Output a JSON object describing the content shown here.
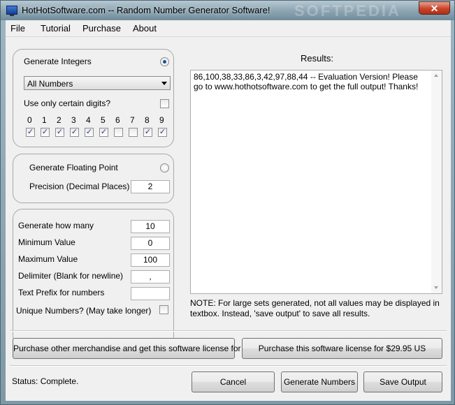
{
  "window": {
    "title": "HotHotSoftware.com -- Random Number Generator Software!",
    "watermark": "SOFTPEDIA",
    "close_glyph": "✕"
  },
  "menu": [
    "File",
    "Tutorial",
    "Purchase",
    "About"
  ],
  "integers": {
    "label": "Generate Integers",
    "selected": true,
    "dropdown_value": "All Numbers",
    "only_digits_label": "Use only certain digits?",
    "only_digits_checked": false,
    "digits": [
      {
        "label": "0",
        "checked": true
      },
      {
        "label": "1",
        "checked": true
      },
      {
        "label": "2",
        "checked": true
      },
      {
        "label": "3",
        "checked": true
      },
      {
        "label": "4",
        "checked": true
      },
      {
        "label": "5",
        "checked": true
      },
      {
        "label": "6",
        "checked": false
      },
      {
        "label": "7",
        "checked": false
      },
      {
        "label": "8",
        "checked": true
      },
      {
        "label": "9",
        "checked": true
      }
    ]
  },
  "floating": {
    "label": "Generate Floating Point",
    "selected": false,
    "precision_label": "Precision (Decimal Places)",
    "precision_value": "2"
  },
  "options": {
    "how_many_label": "Generate how many",
    "how_many_value": "10",
    "min_label": "Minimum Value",
    "min_value": "0",
    "max_label": "Maximum Value",
    "max_value": "100",
    "delim_label": "Delimiter (Blank for newline)",
    "delim_value": ",",
    "prefix_label": "Text Prefix for numbers",
    "prefix_value": "",
    "unique_label": "Unique Numbers? (May take longer)",
    "unique_checked": false
  },
  "results": {
    "heading": "Results:",
    "text": "86,100,38,33,86,3,42,97,88,44 -- Evaluation Version! Please go to www.hothotsoftware.com to get the full output! Thanks!",
    "note": "NOTE: For large sets generated, not all values may be displayed in textbox. Instead, 'save output' to save all results."
  },
  "buttons": {
    "merch": "Purchase other merchandise and get this software license for free",
    "license": "Purchase this software license for $29.95 US",
    "cancel": "Cancel",
    "generate": "Generate Numbers",
    "save": "Save Output"
  },
  "status": "Status: Complete.",
  "icons": {
    "app": "app-monitor-icon",
    "close": "close-icon",
    "dropdown": "chevron-down-icon",
    "check": "✓"
  }
}
